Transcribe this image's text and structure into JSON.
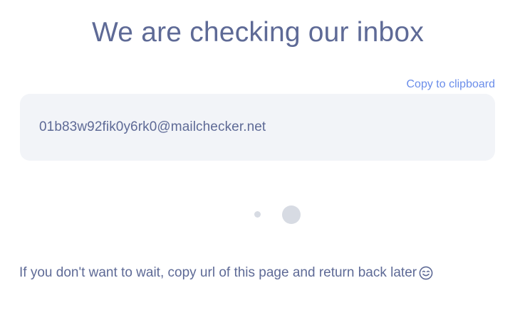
{
  "title": "We are checking our inbox",
  "copy_link_label": "Copy to clipboard",
  "email": "01b83w92fik0y6rk0@mailchecker.net",
  "footer_text": "If you don't want to wait, copy url of this page and return back later",
  "footer_icon": "smiling-face-icon",
  "colors": {
    "text": "#5e6a96",
    "accent": "#6a8dea",
    "email_box_bg": "#f2f4f8",
    "loader_dots": "#d7dbe3"
  }
}
